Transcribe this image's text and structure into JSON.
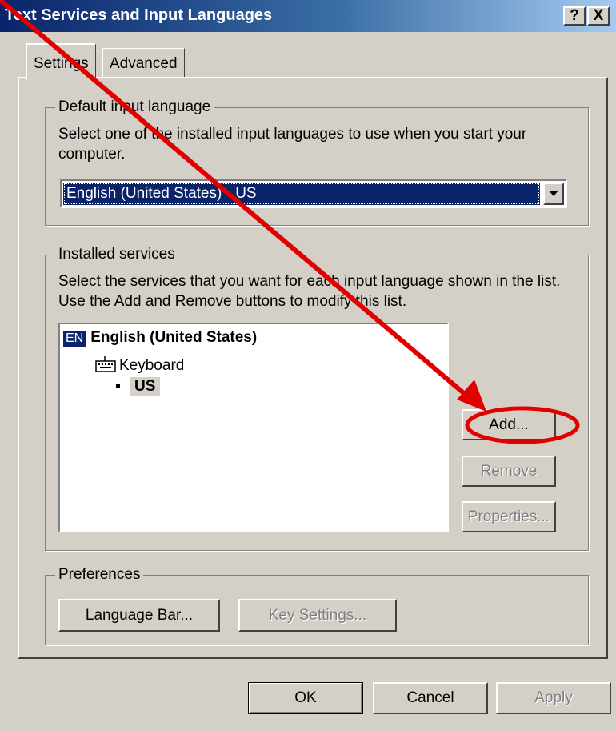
{
  "window": {
    "title": "Text Services and Input Languages",
    "help_label": "?",
    "close_label": "X"
  },
  "tabs": [
    {
      "label": "Settings",
      "active": true
    },
    {
      "label": "Advanced",
      "active": false
    }
  ],
  "default_input": {
    "legend": "Default input language",
    "description": "Select one of the installed input languages to use when you start your computer.",
    "selected": "English (United States) - US"
  },
  "installed_services": {
    "legend": "Installed services",
    "description": "Select the services that you want for each input language shown in the list. Use the Add and Remove buttons to modify this list.",
    "tree": {
      "language_badge": "EN",
      "language": "English (United States)",
      "category": "Keyboard",
      "layout": "US"
    },
    "buttons": {
      "add": "Add...",
      "remove": "Remove",
      "properties": "Properties..."
    }
  },
  "preferences": {
    "legend": "Preferences",
    "language_bar": "Language Bar...",
    "key_settings": "Key Settings..."
  },
  "footer": {
    "ok": "OK",
    "cancel": "Cancel",
    "apply": "Apply"
  },
  "annotation_color": "#e00000"
}
